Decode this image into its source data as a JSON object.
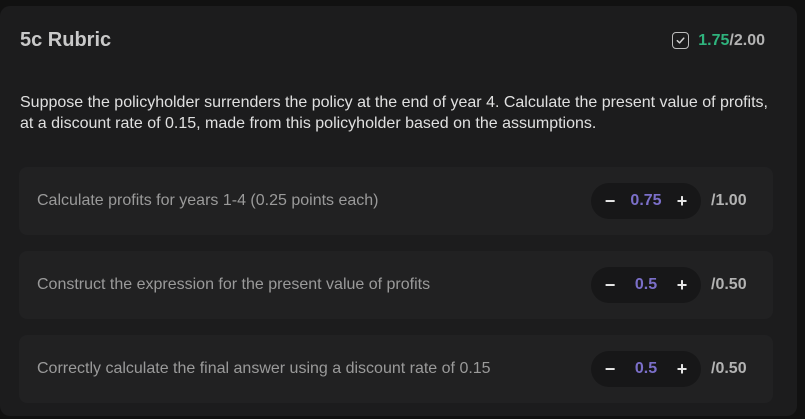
{
  "header": {
    "title": "5c Rubric",
    "score_awarded": "1.75",
    "score_total": "/2.00",
    "icon": "checkbox-check-icon"
  },
  "question": "Suppose the policyholder surrenders the policy at the end of year 4. Calculate the present value of profits, at a discount rate of 0.15, made from this policyholder based on the assumptions.",
  "criteria": [
    {
      "label": "Calculate profits for years 1-4 (0.25 points each)",
      "value": "0.75",
      "max": "/1.00"
    },
    {
      "label": "Construct the expression for the present value of profits",
      "value": "0.5",
      "max": "/0.50"
    },
    {
      "label": "Correctly calculate the final answer using a discount rate of 0.15",
      "value": "0.5",
      "max": "/0.50"
    }
  ],
  "controls": {
    "minus": "−",
    "plus": "+"
  },
  "colors": {
    "score_green": "#2fb37d",
    "value_purple": "#7b6fc9",
    "card_bg": "#1c1c1d"
  }
}
